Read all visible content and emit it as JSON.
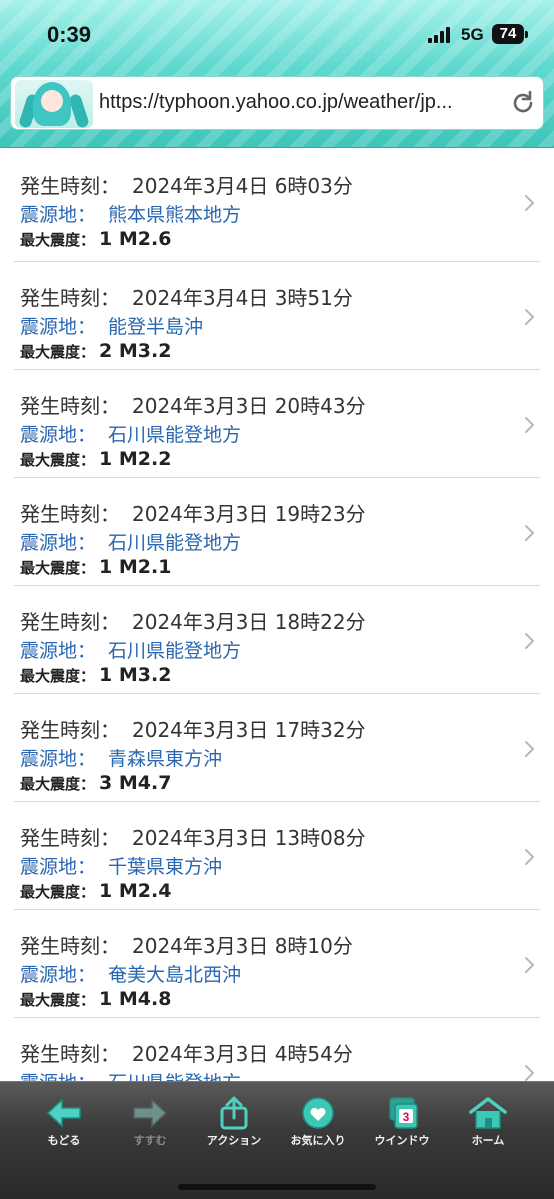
{
  "status_bar": {
    "time": "0:39",
    "network": "5G",
    "battery": "74"
  },
  "browser": {
    "url": "https://typhoon.yahoo.co.jp/weather/jp..."
  },
  "labels": {
    "time_label": "発生時刻：",
    "epicenter_label": "震源地：",
    "intensity_label": "最大震度："
  },
  "quakes": [
    {
      "time": "2024年3月4日 6時03分",
      "epicenter": "熊本県熊本地方",
      "intensity": "1",
      "magnitude": "M2.6"
    },
    {
      "time": "2024年3月4日 3時51分",
      "epicenter": "能登半島沖",
      "intensity": "2",
      "magnitude": "M3.2"
    },
    {
      "time": "2024年3月3日 20時43分",
      "epicenter": "石川県能登地方",
      "intensity": "1",
      "magnitude": "M2.2"
    },
    {
      "time": "2024年3月3日 19時23分",
      "epicenter": "石川県能登地方",
      "intensity": "1",
      "magnitude": "M2.1"
    },
    {
      "time": "2024年3月3日 18時22分",
      "epicenter": "石川県能登地方",
      "intensity": "1",
      "magnitude": "M3.2"
    },
    {
      "time": "2024年3月3日 17時32分",
      "epicenter": "青森県東方沖",
      "intensity": "3",
      "magnitude": "M4.7"
    },
    {
      "time": "2024年3月3日 13時08分",
      "epicenter": "千葉県東方沖",
      "intensity": "1",
      "magnitude": "M2.4"
    },
    {
      "time": "2024年3月3日 8時10分",
      "epicenter": "奄美大島北西沖",
      "intensity": "1",
      "magnitude": "M4.8"
    },
    {
      "time": "2024年3月3日 4時54分",
      "epicenter": "石川県能登地方",
      "intensity": "",
      "magnitude": ""
    }
  ],
  "toolbar": {
    "back": "もどる",
    "forward": "すすむ",
    "action": "アクション",
    "favorites": "お気に入り",
    "window": "ウインドウ",
    "window_count": "3",
    "home": "ホーム"
  },
  "colors": {
    "header_teal": "#5fd9cf",
    "link_blue": "#2a67b1",
    "toolbar_dark": "#3a3a3a",
    "icon_green": "#3dc7b5"
  },
  "icons": {
    "back": "arrow-left-icon",
    "forward": "arrow-right-icon",
    "action": "share-icon",
    "favorites": "heart-badge-icon",
    "window": "windows-icon",
    "home": "home-icon",
    "reload": "reload-icon",
    "row": "chevron-right-icon"
  }
}
